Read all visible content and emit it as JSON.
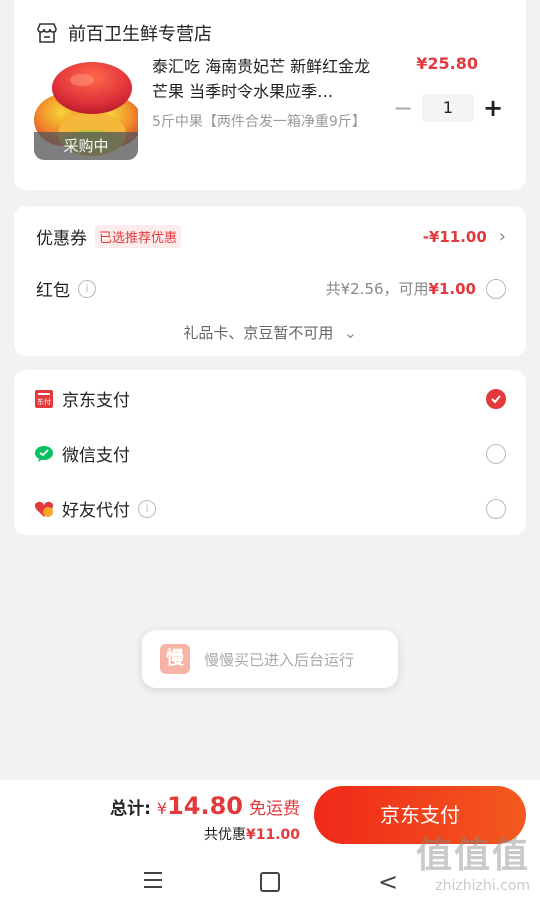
{
  "store": {
    "name": "前百卫生鲜专营店"
  },
  "product": {
    "title": "泰汇吃 海南贵妃芒 新鲜红金龙芒果 当季时令水果应季…",
    "spec": "5斤中果【两件合发一箱净重9斤】",
    "tag": "采购中",
    "price": "¥25.80",
    "quantity": "1",
    "minus": "−",
    "plus": "+"
  },
  "discounts": {
    "coupon_label": "优惠券",
    "coupon_tag": "已选推荐优惠",
    "coupon_amount": "-¥11.00",
    "hongbao_label": "红包",
    "hongbao_available": "共¥2.56，可用",
    "hongbao_usable_amount": "¥1.00",
    "unavailable_text": "礼品卡、京豆暂不可用"
  },
  "payment": {
    "options": [
      {
        "label": "京东支付",
        "selected": true
      },
      {
        "label": "微信支付",
        "selected": false
      },
      {
        "label": "好友代付",
        "selected": false
      }
    ]
  },
  "toast": {
    "icon_text": "慢",
    "text": "慢慢买已进入后台运行"
  },
  "footer": {
    "total_label": "总计:",
    "total_symbol": "¥",
    "total_amount": "14.80",
    "free_shipping": "免运费",
    "saving_label": "共优惠",
    "saving_amount": "¥11.00",
    "pay_button": "京东支付"
  },
  "watermark": {
    "big": "值值值",
    "small": "zhizhizhi.com"
  },
  "colors": {
    "accent_red": "#e4393c",
    "button_gradient_start": "#f0281a",
    "button_gradient_end": "#f25a1e",
    "wechat_green": "#07c160"
  }
}
